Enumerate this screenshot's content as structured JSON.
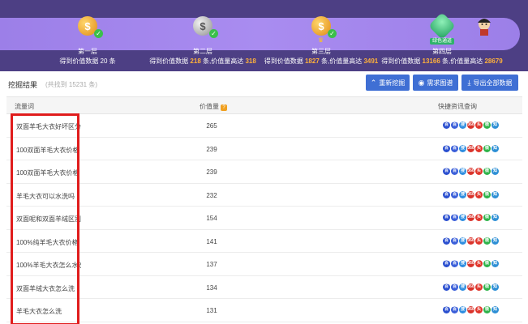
{
  "levels": [
    {
      "name": "第一层",
      "desc_prefix": "得到价值数据 20 条",
      "desc_hl1": "",
      "desc_mid": "",
      "desc_hl2": "",
      "coin": "gold",
      "coin_glyph": "$"
    },
    {
      "name": "第二层",
      "desc_prefix": "得到价值数据 ",
      "desc_hl1": "218",
      "desc_mid": " 条,价值量高达 ",
      "desc_hl2": "318",
      "coin": "silver",
      "coin_glyph": "$"
    },
    {
      "name": "第三层",
      "desc_prefix": "得到价值数据 ",
      "desc_hl1": "1827",
      "desc_mid": " 条,价值量高达 ",
      "desc_hl2": "3491",
      "coin": "gold",
      "coin_glyph": "$"
    },
    {
      "name": "第四层",
      "desc_prefix": "得到价值数据 ",
      "desc_hl1": "13166",
      "desc_mid": " 条,价值量高达 ",
      "desc_hl2": "28679",
      "coin": "gem",
      "coin_glyph": "",
      "tag": "绿色通道"
    }
  ],
  "toolbar": {
    "title": "挖掘结果",
    "subtitle": "(共找到 15231 条)",
    "btn_refresh": "重新挖掘",
    "btn_map": "需求图谱",
    "btn_export": "导出全部数据"
  },
  "table": {
    "headers": {
      "keyword": "流量词",
      "value": "价值量",
      "value_help": "?",
      "links": "快捷资讯查询"
    },
    "rows": [
      {
        "keyword": "双面羊毛大衣好坏区分",
        "value": "265"
      },
      {
        "keyword": "100双面羊毛大衣价格",
        "value": "239"
      },
      {
        "keyword": "100双面羊毛大衣价格",
        "value": "239"
      },
      {
        "keyword": "羊毛大衣可以水洗吗",
        "value": "232"
      },
      {
        "keyword": "双面呢和双面羊绒区别",
        "value": "154"
      },
      {
        "keyword": "100%纯羊毛大衣价格",
        "value": "141"
      },
      {
        "keyword": "100%羊毛大衣怎么水洗",
        "value": "137"
      },
      {
        "keyword": "双面羊绒大衣怎么洗",
        "value": "134"
      },
      {
        "keyword": "羊毛大衣怎么洗",
        "value": "131"
      }
    ],
    "link_icons": [
      {
        "name": "baidu-icon",
        "color": "#2a4fcf",
        "glyph": "百"
      },
      {
        "name": "baidu-mobile-icon",
        "color": "#3b5fd9",
        "glyph": "百"
      },
      {
        "name": "sogou-icon",
        "color": "#2f8ee0",
        "glyph": "搜"
      },
      {
        "name": "360-icon",
        "color": "#d9332b",
        "glyph": "360"
      },
      {
        "name": "toutiao-icon",
        "color": "#e0352b",
        "glyph": "头"
      },
      {
        "name": "wechat-icon",
        "color": "#2fb34a",
        "glyph": "微"
      },
      {
        "name": "zhihu-icon",
        "color": "#2d8fd5",
        "glyph": "知"
      }
    ]
  },
  "colors": {
    "banner": "#4d3f84",
    "accent": "#3f6fd4",
    "highlight": "#e01c1c",
    "value_hl": "#ffb13b"
  }
}
